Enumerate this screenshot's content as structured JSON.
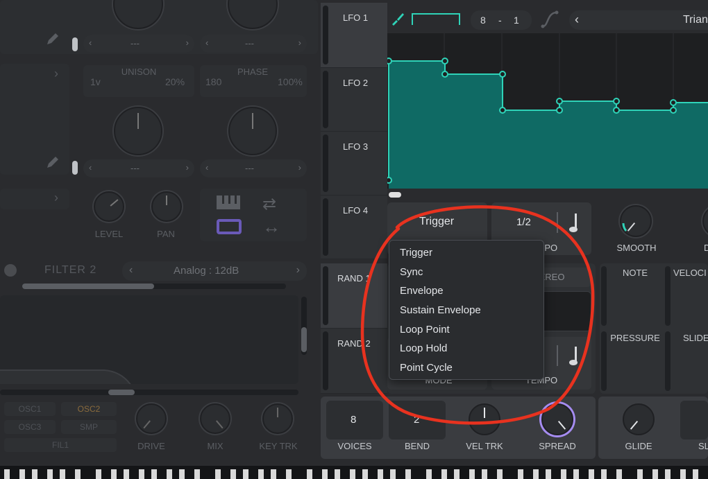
{
  "left": {
    "unison_label": "UNISON",
    "unison_voices": "1v",
    "unison_detune": "20%",
    "phase_label": "PHASE",
    "phase_value": "180",
    "phase_random": "100%",
    "selector_dash": "---",
    "level_label": "LEVEL",
    "pan_label": "PAN",
    "filter2_title": "FILTER 2",
    "filter2_type": "Analog : 12dB",
    "routing": [
      "OSC1",
      "OSC2",
      "OSC3",
      "SMP",
      "FIL1"
    ],
    "drive_label": "DRIVE",
    "mix_label": "MIX",
    "keytrk_label": "KEY TRK"
  },
  "lfo": {
    "tabs": [
      "LFO 1",
      "LFO 2",
      "LFO 3",
      "LFO 4"
    ],
    "grid_x": "8",
    "grid_sep": "-",
    "grid_y": "1",
    "preset_name": "Trian",
    "mode_label": "Trigger",
    "rate_value": "1/2",
    "tempo_label": "TEMPO",
    "smooth_label": "SMOOTH"
  },
  "rand": {
    "tabs": [
      "RAND 1",
      "RAND 2"
    ],
    "stereo_label": "STEREO",
    "mode_label": "MODE",
    "tempo_label": "TEMPO"
  },
  "sources": {
    "note_label": "NOTE",
    "velocity_label": "VELOCI",
    "pressure_label": "PRESSURE",
    "slide_label": "SLIDE"
  },
  "voice": {
    "voices_value": "8",
    "voices_label": "VOICES",
    "bend_value": "2",
    "bend_label": "BEND",
    "veltrk_label": "VEL TRK",
    "spread_label": "SPREAD",
    "glide_label": "GLIDE",
    "sl_label": "SL"
  },
  "dropdown": {
    "items": [
      "Trigger",
      "Sync",
      "Envelope",
      "Sustain Envelope",
      "Loop Point",
      "Loop Hold",
      "Point Cycle"
    ]
  },
  "colors": {
    "accent": "#2fd3b8",
    "wave_fill": "#0f6a64",
    "spread_purple": "#a58cf0",
    "annotation_red": "#e8321f"
  }
}
